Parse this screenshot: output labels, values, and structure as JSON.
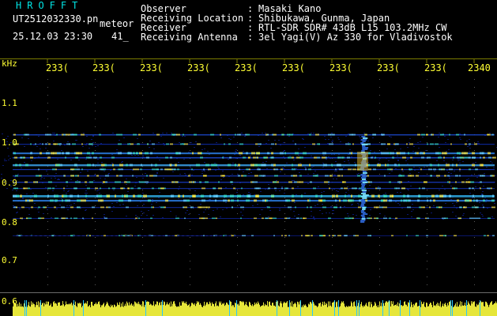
{
  "header": {
    "logo": "HROFFT",
    "filename": "UT2512032330.pn",
    "meteor_label": "meteor",
    "datetime": "25.12.03 23:30",
    "count": "41_"
  },
  "info": [
    {
      "key": "Observer",
      "sep": ":",
      "value": "Masaki Kano"
    },
    {
      "key": "Receiving Location",
      "sep": ":",
      "value": "Shibukawa, Gunma, Japan"
    },
    {
      "key": "Receiver",
      "sep": ":",
      "value": "RTL-SDR SDR# 43dB L15 103.2MHz CW"
    },
    {
      "key": "Receiving Antenna",
      "sep": ":",
      "value": "3el Yagi(V) Az 330 for Vladivostok"
    }
  ],
  "axis": {
    "unit": "kHz",
    "time_labels": [
      "233(",
      "233(",
      "233(",
      "233(",
      "233(",
      "233(",
      "233(",
      "233(",
      "233(",
      "2340"
    ],
    "freq_labels": [
      "1.1",
      "1.0",
      "0.9",
      "0.8",
      "0.7",
      "0.6"
    ]
  },
  "colors": {
    "text_cyan": "#00e5e5",
    "text_yellow": "#ffff33",
    "background": "#000000",
    "spectrogram_noise": "#0a1a9a"
  }
}
